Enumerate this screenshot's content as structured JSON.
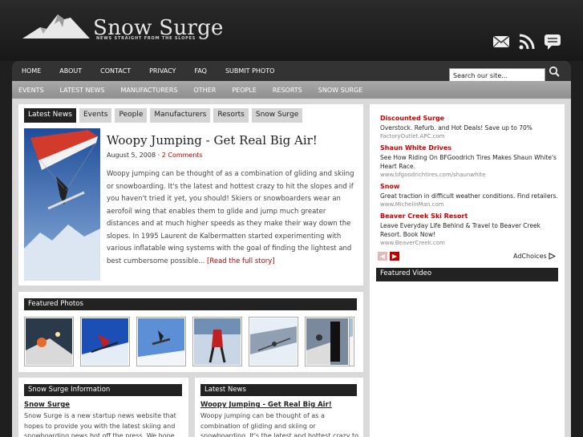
{
  "site": {
    "name": "Snow Surge",
    "tagline": "NEWS STRAIGHT FROM THE SLOPES"
  },
  "top_icons": [
    "mail-icon",
    "rss-icon",
    "comment-icon"
  ],
  "nav": [
    "HOME",
    "ABOUT",
    "CONTACT",
    "PRIVACY",
    "FAQ",
    "SUBMIT PHOTO"
  ],
  "search": {
    "value": "Search our site..."
  },
  "categories": [
    "EVENTS",
    "LATEST NEWS",
    "MANUFACTURERS",
    "OTHER",
    "PEOPLE",
    "RESORTS",
    "SNOW SURGE"
  ],
  "tabs": [
    "Latest News",
    "Events",
    "People",
    "Manufacturers",
    "Resorts",
    "Snow Surge"
  ],
  "article": {
    "title": "Woopy Jumping - Get Real Big Air!",
    "date": "August 5, 2008",
    "sep": " · ",
    "comments": "2 Comments",
    "body": "Woopy jumping can be thought of as a combination of gliding and skiing or snowboarding. It's the latest and hottest crazy to hit the slopes and if you haven't tried it yet, you should! Skiers or snowboarders wear an aerofoil wing that enables them to glide and jump much greater distances and at much higher speeds as they make their way down the slopes. In 1995 Laurent de Kalbermatten started experimenting with various inflatable wing systems with the goal of finding the lightest and best cumbersome possible... ",
    "read_more": "[Read the full story]"
  },
  "featured_photos": {
    "heading": "Featured Photos"
  },
  "snow_surge_info": {
    "heading": "Snow Surge Information",
    "title": "Snow Surge",
    "text": "Snow Surge is a new startup news website that hopes to provide you with the latest skiing and snowboarding news hot off the press. We hope that"
  },
  "latest_news": {
    "heading": "Latest News",
    "title": "Woopy Jumping - Get Real Big Air!",
    "text": "Woopy jumping can be thought of as a combination of gliding and skiing or snowboarding. It's the latest and hottest crazy to hit the slopes and if you haven't"
  },
  "ads": [
    {
      "title": "Discounted Surge",
      "text": "Overstock. Refurb. and Hot Deals! Save up to 70%",
      "url": "FactoryOutlet.APC.com"
    },
    {
      "title": "Shaun White Drives",
      "text": "See How Riding On BFGoodrich Tires Makes Shaun White's Heart Race.",
      "url": "www.bfgoodrichtires.com/shaunwhite"
    },
    {
      "title": "Snow",
      "text": "Great traction in difficult weather conditions. Find retailers.",
      "url": "www.MichelinMan.com"
    },
    {
      "title": "Beaver Creek Ski Resort",
      "text": "Leave Everyday Life Behind & Travel to Beaver Creek Resort. Book Now!",
      "url": "www.BeaverCreek.com"
    }
  ],
  "adchoices": "AdChoices",
  "featured_video": {
    "heading": "Featured Video"
  },
  "colors": {
    "accent": "#bb0000",
    "nav_bg": "#333333",
    "category_bar": "#9a9a9a"
  }
}
